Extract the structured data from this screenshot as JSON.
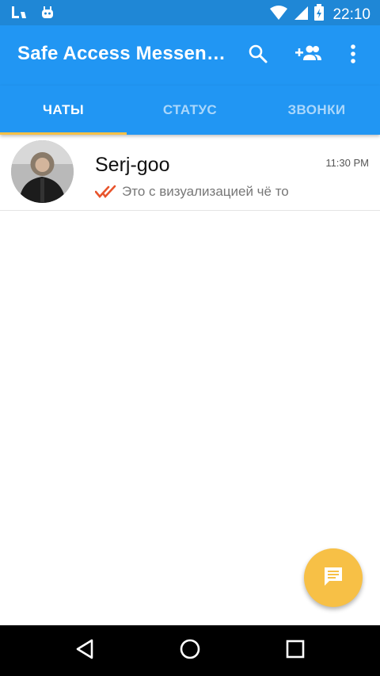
{
  "status_bar": {
    "time": "22:10",
    "icons": [
      "notification-app-icon",
      "android-debug-icon",
      "wifi-icon",
      "signal-icon",
      "battery-charging-icon"
    ]
  },
  "app_bar": {
    "title": "Safe Access Messenger",
    "actions": [
      "search-icon",
      "add-contact-icon",
      "more-vert-icon"
    ]
  },
  "tabs": [
    {
      "label": "ЧАТЫ",
      "active": true
    },
    {
      "label": "СТАТУС",
      "active": false
    },
    {
      "label": "ЗВОНКИ",
      "active": false
    }
  ],
  "chats": [
    {
      "name": "Serj-goo",
      "time": "11:30 PM",
      "preview": "Это с визуализацией чё то",
      "status_icon": "double-check-icon"
    }
  ],
  "fab": {
    "icon": "message-icon"
  },
  "nav_bar": {
    "buttons": [
      "back-icon",
      "home-icon",
      "recents-icon"
    ]
  },
  "colors": {
    "status_bar": "#1f87d6",
    "primary": "#2196f3",
    "accent": "#f7c046",
    "read_check": "#e8542c"
  }
}
